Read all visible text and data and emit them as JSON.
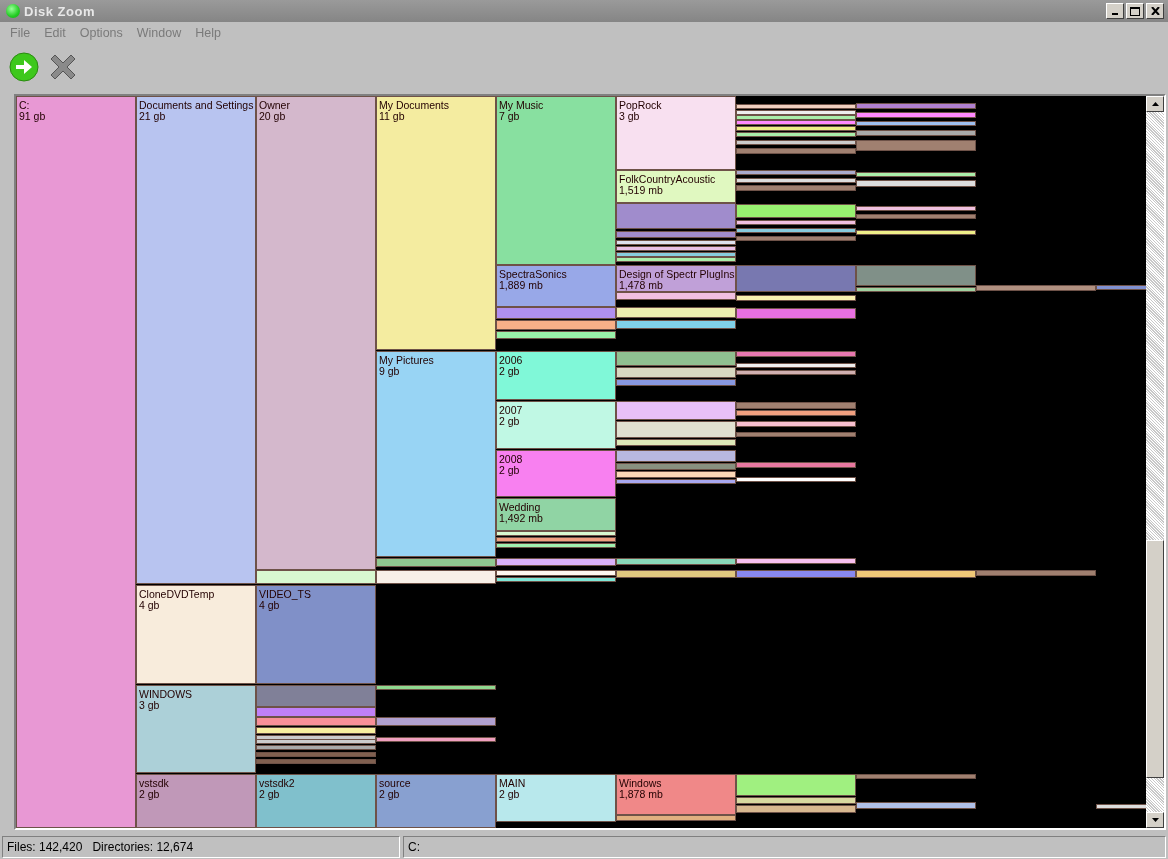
{
  "window": {
    "title": "Disk Zoom"
  },
  "menu": [
    "File",
    "Edit",
    "Options",
    "Window",
    "Help"
  ],
  "tree": [
    {
      "name": "C:",
      "size": "91 gb",
      "color": "#e898d4",
      "children": [
        {
          "name": "Documents and Settings",
          "size": "21 gb",
          "color": "#b8c4f0",
          "children": [
            {
              "name": "Owner",
              "size": "20 gb",
              "color": "#d4b8cc",
              "children": [
                {
                  "name": "My Documents",
                  "size": "11 gb",
                  "color": "#f4eca0",
                  "children": [
                    {
                      "name": "My Music",
                      "size": "7 gb",
                      "color": "#88e0a0",
                      "children": [
                        {
                          "name": "PopRock",
                          "size": "3 gb",
                          "color": "#f8e0f0"
                        },
                        {
                          "name": "FolkCountryAcoustic",
                          "size": "1,519 mb",
                          "color": "#e0f8c0"
                        }
                      ]
                    },
                    {
                      "name": "SpectraSonics",
                      "size": "1,889 mb",
                      "color": "#98a8e8",
                      "children": [
                        {
                          "name": "Design of Spectr PlugIns",
                          "size": "1,478 mb",
                          "color": "#c0a0d8"
                        }
                      ]
                    }
                  ]
                },
                {
                  "name": "My Pictures",
                  "size": "9 gb",
                  "color": "#98d4f4",
                  "children": [
                    {
                      "name": "2006",
                      "size": "2 gb",
                      "color": "#80f8d8"
                    },
                    {
                      "name": "2007",
                      "size": "2 gb",
                      "color": "#c0f8e4"
                    },
                    {
                      "name": "2008",
                      "size": "2 gb",
                      "color": "#f880f0"
                    },
                    {
                      "name": "Wedding",
                      "size": "1,492 mb",
                      "color": "#90d4a4"
                    }
                  ]
                }
              ]
            }
          ]
        },
        {
          "name": "CloneDVDTemp",
          "size": "4 gb",
          "color": "#f8ecdc",
          "children": [
            {
              "name": "VIDEO_TS",
              "size": "4 gb",
              "color": "#8090c8"
            }
          ]
        },
        {
          "name": "WINDOWS",
          "size": "3 gb",
          "color": "#acd0d8"
        },
        {
          "name": "vstsdk",
          "size": "2 gb",
          "color": "#c098b8",
          "children": [
            {
              "name": "vstsdk2",
              "size": "2 gb",
              "color": "#80c0cc",
              "children": [
                {
                  "name": "source",
                  "size": "2 gb",
                  "color": "#88a0d0",
                  "children": [
                    {
                      "name": "MAIN",
                      "size": "2 gb",
                      "color": "#b8e8ec",
                      "children": [
                        {
                          "name": "Windows",
                          "size": "1,878 mb",
                          "color": "#f08888"
                        }
                      ]
                    }
                  ]
                }
              ]
            }
          ]
        }
      ]
    }
  ],
  "status_bar": [
    "Files: 142,420   Directories: 12,674",
    "C:"
  ]
}
